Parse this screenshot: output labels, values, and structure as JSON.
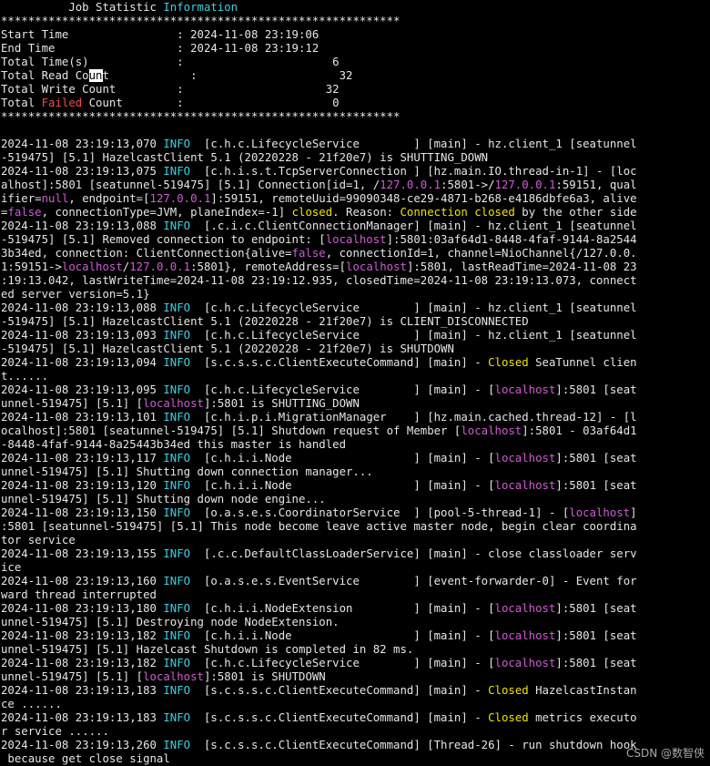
{
  "colors": {
    "background": "#000000",
    "text": "#e6e6e6",
    "cyan": "#3bd1e3",
    "red": "#f24d4d",
    "magenta": "#d05ad6",
    "yellow": "#f0e300",
    "cursor_highlight": "#ffffff"
  },
  "watermark": "CSDN @数智侠",
  "lines": [
    [
      {
        "t": "          Job Statistic "
      },
      {
        "t": "Information",
        "c": "cyan"
      }
    ],
    [
      {
        "t": "***********************************************************"
      }
    ],
    [
      {
        "t": "Start Time                : 2024-11-08 23:19:06"
      }
    ],
    [
      {
        "t": "End Time                  : 2024-11-08 23:19:12"
      }
    ],
    [
      {
        "t": "Total Time(s)             :                      6"
      }
    ],
    [
      {
        "t": "Total Read Co"
      },
      {
        "t": "un",
        "c": "hl"
      },
      {
        "t": "t            :                     32"
      }
    ],
    [
      {
        "t": "Total Write Count         :                     32"
      }
    ],
    [
      {
        "t": "Total "
      },
      {
        "t": "Failed",
        "c": "red"
      },
      {
        "t": " Count        :                      0"
      }
    ],
    [
      {
        "t": "***********************************************************"
      }
    ],
    [],
    [
      {
        "t": "2024-11-08 23:19:13,070 "
      },
      {
        "t": "INFO",
        "c": "cyan"
      },
      {
        "t": "  [c.h.c.LifecycleService        ] [main] - hz.client_1 [seatunnel"
      }
    ],
    [
      {
        "t": "-519475] [5.1] HazelcastClient 5.1 (20220228 - 21f20e7) is SHUTTING_DOWN"
      }
    ],
    [
      {
        "t": "2024-11-08 23:19:13,075 "
      },
      {
        "t": "INFO",
        "c": "cyan"
      },
      {
        "t": "  [c.h.i.s.t.TcpServerConnection ] [hz.main.IO.thread-in-1] - [loc"
      }
    ],
    [
      {
        "t": "alhost]:5801 [seatunnel-519475] [5.1] Connection[id=1, /"
      },
      {
        "t": "127.0.0.1",
        "c": "mag"
      },
      {
        "t": ":5801->/"
      },
      {
        "t": "127.0.0.1",
        "c": "mag"
      },
      {
        "t": ":59151, qual"
      }
    ],
    [
      {
        "t": "ifier="
      },
      {
        "t": "null",
        "c": "mag"
      },
      {
        "t": ", endpoint=["
      },
      {
        "t": "127.0.0.1",
        "c": "mag"
      },
      {
        "t": "]:59151, remoteUuid=99090348-ce29-4871-b268-e4186dbfe6a3, alive"
      }
    ],
    [
      {
        "t": "="
      },
      {
        "t": "false",
        "c": "mag"
      },
      {
        "t": ", connectionType=JVM, planeIndex=-1] "
      },
      {
        "t": "closed",
        "c": "yel"
      },
      {
        "t": ". Reason: "
      },
      {
        "t": "Connection closed",
        "c": "yel"
      },
      {
        "t": " by the other side"
      }
    ],
    [
      {
        "t": "2024-11-08 23:19:13,088 "
      },
      {
        "t": "INFO",
        "c": "cyan"
      },
      {
        "t": "  [.c.i.c.ClientConnectionManager] [main] - hz.client_1 [seatunnel"
      }
    ],
    [
      {
        "t": "-519475] [5.1] Removed connection to endpoint: ["
      },
      {
        "t": "localhost",
        "c": "mag"
      },
      {
        "t": "]:5801:03af64d1-8448-4faf-9144-8a2544"
      }
    ],
    [
      {
        "t": "3b34ed, connection: ClientConnection{alive="
      },
      {
        "t": "false",
        "c": "mag"
      },
      {
        "t": ", connectionId=1, channel=NioChannel{/127.0.0."
      }
    ],
    [
      {
        "t": "1:59151->"
      },
      {
        "t": "localhost",
        "c": "mag"
      },
      {
        "t": "/"
      },
      {
        "t": "127.0.0.1",
        "c": "mag"
      },
      {
        "t": ":5801}, remoteAddress=["
      },
      {
        "t": "localhost",
        "c": "mag"
      },
      {
        "t": "]:5801, lastReadTime=2024-11-08 23"
      }
    ],
    [
      {
        "t": ":19:13.042, lastWriteTime=2024-11-08 23:19:12.935, closedTime=2024-11-08 23:19:13.073, connect"
      }
    ],
    [
      {
        "t": "ed server version=5.1}"
      }
    ],
    [
      {
        "t": "2024-11-08 23:19:13,088 "
      },
      {
        "t": "INFO",
        "c": "cyan"
      },
      {
        "t": "  [c.h.c.LifecycleService        ] [main] - hz.client_1 [seatunnel"
      }
    ],
    [
      {
        "t": "-519475] [5.1] HazelcastClient 5.1 (20220228 - 21f20e7) is CLIENT_DISCONNECTED"
      }
    ],
    [
      {
        "t": "2024-11-08 23:19:13,093 "
      },
      {
        "t": "INFO",
        "c": "cyan"
      },
      {
        "t": "  [c.h.c.LifecycleService        ] [main] - hz.client_1 [seatunnel"
      }
    ],
    [
      {
        "t": "-519475] [5.1] HazelcastClient 5.1 (20220228 - 21f20e7) is SHUTDOWN"
      }
    ],
    [
      {
        "t": "2024-11-08 23:19:13,094 "
      },
      {
        "t": "INFO",
        "c": "cyan"
      },
      {
        "t": "  [s.c.s.s.c.ClientExecuteCommand] [main] - "
      },
      {
        "t": "Closed",
        "c": "yel"
      },
      {
        "t": " SeaTunnel clien"
      }
    ],
    [
      {
        "t": "t......"
      }
    ],
    [
      {
        "t": "2024-11-08 23:19:13,095 "
      },
      {
        "t": "INFO",
        "c": "cyan"
      },
      {
        "t": "  [c.h.c.LifecycleService        ] [main] - ["
      },
      {
        "t": "localhost",
        "c": "mag"
      },
      {
        "t": "]:5801 [seat"
      }
    ],
    [
      {
        "t": "unnel-519475] [5.1] ["
      },
      {
        "t": "localhost",
        "c": "mag"
      },
      {
        "t": "]:5801 is SHUTTING_DOWN"
      }
    ],
    [
      {
        "t": "2024-11-08 23:19:13,101 "
      },
      {
        "t": "INFO",
        "c": "cyan"
      },
      {
        "t": "  [c.h.i.p.i.MigrationManager    ] [hz.main.cached.thread-12] - [l"
      }
    ],
    [
      {
        "t": "ocalhost]:5801 [seatunnel-519475] [5.1] Shutdown request of Member ["
      },
      {
        "t": "localhost",
        "c": "mag"
      },
      {
        "t": "]:5801 - 03af64d1"
      }
    ],
    [
      {
        "t": "-8448-4faf-9144-8a25443b34ed this master is handled"
      }
    ],
    [
      {
        "t": "2024-11-08 23:19:13,117 "
      },
      {
        "t": "INFO",
        "c": "cyan"
      },
      {
        "t": "  [c.h.i.i.Node                  ] [main] - ["
      },
      {
        "t": "localhost",
        "c": "mag"
      },
      {
        "t": "]:5801 [seat"
      }
    ],
    [
      {
        "t": "unnel-519475] [5.1] Shutting down connection manager..."
      }
    ],
    [
      {
        "t": "2024-11-08 23:19:13,120 "
      },
      {
        "t": "INFO",
        "c": "cyan"
      },
      {
        "t": "  [c.h.i.i.Node                  ] [main] - ["
      },
      {
        "t": "localhost",
        "c": "mag"
      },
      {
        "t": "]:5801 [seat"
      }
    ],
    [
      {
        "t": "unnel-519475] [5.1] Shutting down node engine..."
      }
    ],
    [
      {
        "t": "2024-11-08 23:19:13,150 "
      },
      {
        "t": "INFO",
        "c": "cyan"
      },
      {
        "t": "  [o.a.s.e.s.CoordinatorService  ] [pool-5-thread-1] - ["
      },
      {
        "t": "localhost",
        "c": "mag"
      },
      {
        "t": "]"
      }
    ],
    [
      {
        "t": ":5801 [seatunnel-519475] [5.1] This node become leave active master node, begin clear coordina"
      }
    ],
    [
      {
        "t": "tor service"
      }
    ],
    [
      {
        "t": "2024-11-08 23:19:13,155 "
      },
      {
        "t": "INFO",
        "c": "cyan"
      },
      {
        "t": "  [.c.c.DefaultClassLoaderService] [main] - close classloader serv"
      }
    ],
    [
      {
        "t": "ice"
      }
    ],
    [
      {
        "t": "2024-11-08 23:19:13,160 "
      },
      {
        "t": "INFO",
        "c": "cyan"
      },
      {
        "t": "  [o.a.s.e.s.EventService        ] [event-forwarder-0] - Event for"
      }
    ],
    [
      {
        "t": "ward thread interrupted"
      }
    ],
    [
      {
        "t": "2024-11-08 23:19:13,180 "
      },
      {
        "t": "INFO",
        "c": "cyan"
      },
      {
        "t": "  [c.h.i.i.NodeExtension         ] [main] - ["
      },
      {
        "t": "localhost",
        "c": "mag"
      },
      {
        "t": "]:5801 [seat"
      }
    ],
    [
      {
        "t": "unnel-519475] [5.1] Destroying node NodeExtension."
      }
    ],
    [
      {
        "t": "2024-11-08 23:19:13,182 "
      },
      {
        "t": "INFO",
        "c": "cyan"
      },
      {
        "t": "  [c.h.i.i.Node                  ] [main] - ["
      },
      {
        "t": "localhost",
        "c": "mag"
      },
      {
        "t": "]:5801 [seat"
      }
    ],
    [
      {
        "t": "unnel-519475] [5.1] Hazelcast Shutdown is completed in 82 ms."
      }
    ],
    [
      {
        "t": "2024-11-08 23:19:13,182 "
      },
      {
        "t": "INFO",
        "c": "cyan"
      },
      {
        "t": "  [c.h.c.LifecycleService        ] [main] - ["
      },
      {
        "t": "localhost",
        "c": "mag"
      },
      {
        "t": "]:5801 [seat"
      }
    ],
    [
      {
        "t": "unnel-519475] [5.1] ["
      },
      {
        "t": "localhost",
        "c": "mag"
      },
      {
        "t": "]:5801 is SHUTDOWN"
      }
    ],
    [
      {
        "t": "2024-11-08 23:19:13,183 "
      },
      {
        "t": "INFO",
        "c": "cyan"
      },
      {
        "t": "  [s.c.s.s.c.ClientExecuteCommand] [main] - "
      },
      {
        "t": "Closed",
        "c": "yel"
      },
      {
        "t": " HazelcastInstan"
      }
    ],
    [
      {
        "t": "ce ......"
      }
    ],
    [
      {
        "t": "2024-11-08 23:19:13,183 "
      },
      {
        "t": "INFO",
        "c": "cyan"
      },
      {
        "t": "  [s.c.s.s.c.ClientExecuteCommand] [main] - "
      },
      {
        "t": "Closed",
        "c": "yel"
      },
      {
        "t": " metrics executo"
      }
    ],
    [
      {
        "t": "r service ......"
      }
    ],
    [
      {
        "t": "2024-11-08 23:19:13,260 "
      },
      {
        "t": "INFO",
        "c": "cyan"
      },
      {
        "t": "  [s.c.s.s.c.ClientExecuteCommand] [Thread-26] - run shutdown hook"
      }
    ],
    [
      {
        "t": " because get close signal"
      }
    ]
  ]
}
